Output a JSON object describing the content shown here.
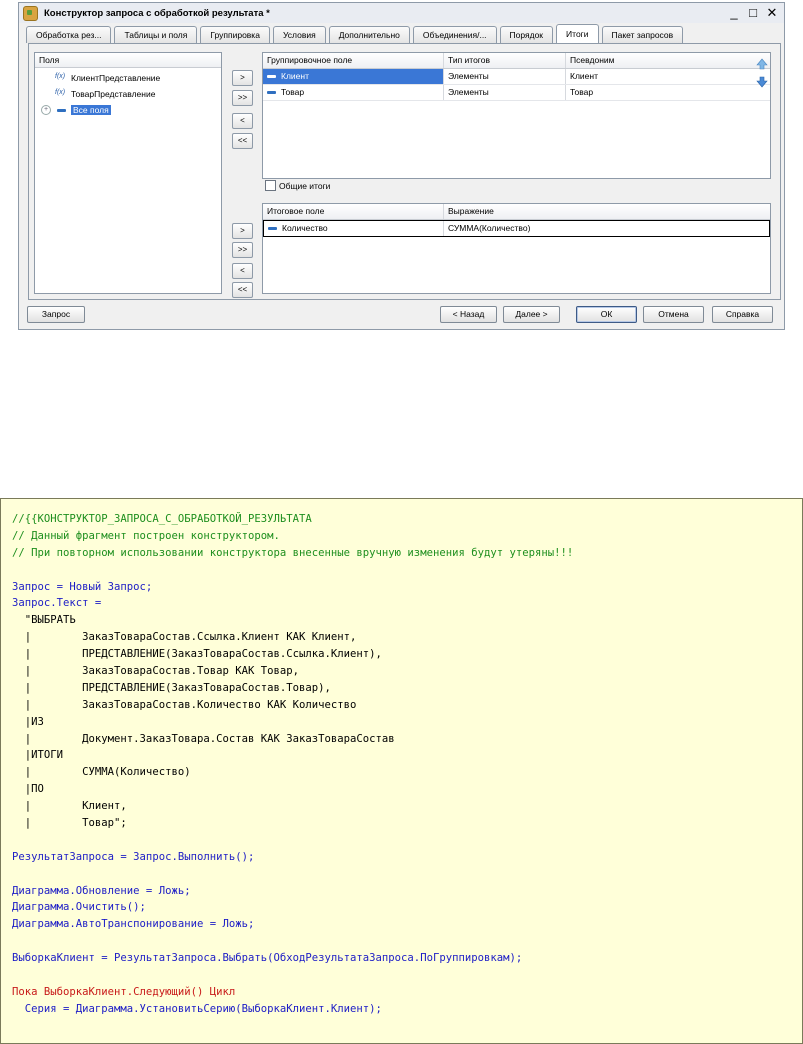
{
  "window": {
    "title": "Конструктор запроса с обработкой результата *",
    "controls": [
      "_",
      "□",
      "✕"
    ]
  },
  "tabs": [
    {
      "label": "Обработка рез...",
      "active": false
    },
    {
      "label": "Таблицы и поля",
      "active": false
    },
    {
      "label": "Группировка",
      "active": false
    },
    {
      "label": "Условия",
      "active": false
    },
    {
      "label": "Дополнительно",
      "active": false
    },
    {
      "label": "Объединения/...",
      "active": false
    },
    {
      "label": "Порядок",
      "active": false
    },
    {
      "label": "Итоги",
      "active": true
    },
    {
      "label": "Пакет запросов",
      "active": false
    }
  ],
  "fields_panel": {
    "header": "Поля",
    "items": [
      {
        "label": "КлиентПредставление",
        "icon": "fx-icon"
      },
      {
        "label": "ТоварПредставление",
        "icon": "fx-icon"
      },
      {
        "label": "Все поля",
        "icon": "line-icon",
        "selected": true
      }
    ]
  },
  "transfer_buttons_top": [
    ">",
    ">>",
    "<",
    "<<"
  ],
  "transfer_buttons_bottom": [
    ">",
    ">>",
    "<",
    "<<"
  ],
  "grouping_table": {
    "columns": [
      "Группировочное поле",
      "Тип итогов",
      "Псевдоним"
    ],
    "rows": [
      [
        "Клиент",
        "Элементы",
        "Клиент"
      ],
      [
        "Товар",
        "Элементы",
        "Товар"
      ]
    ]
  },
  "overall_totals": {
    "label": "Общие итоги",
    "checked": false
  },
  "totals_table": {
    "columns": [
      "Итоговое поле",
      "Выражение"
    ],
    "rows": [
      [
        "Количество",
        "СУММА(Количество)"
      ]
    ]
  },
  "buttons": {
    "query": "Запрос",
    "back": "< Назад",
    "next": "Далее >",
    "ok": "ОК",
    "cancel": "Отмена",
    "help": "Справка"
  },
  "code": {
    "lines": [
      {
        "text": "//{{КОНСТРУКТОР_ЗАПРОСА_С_ОБРАБОТКОЙ_РЕЗУЛЬТАТА",
        "color": "green"
      },
      {
        "text": "// Данный фрагмент построен конструктором.",
        "color": "green"
      },
      {
        "text": "// При повторном использовании конструктора внесенные вручную изменения будут утеряны!!!",
        "color": "green"
      },
      {
        "text": "",
        "color": "black"
      },
      {
        "text": "Запрос = Новый Запрос;",
        "color": "blue"
      },
      {
        "text": "Запрос.Текст =",
        "color": "blue"
      },
      {
        "text": "  \"ВЫБРАТЬ",
        "color": "black"
      },
      {
        "text": "  |        ЗаказТовараСостав.Ссылка.Клиент КАК Клиент,",
        "color": "black"
      },
      {
        "text": "  |        ПРЕДСТАВЛЕНИЕ(ЗаказТовараСостав.Ссылка.Клиент),",
        "color": "black"
      },
      {
        "text": "  |        ЗаказТовараСостав.Товар КАК Товар,",
        "color": "black"
      },
      {
        "text": "  |        ПРЕДСТАВЛЕНИЕ(ЗаказТовараСостав.Товар),",
        "color": "black"
      },
      {
        "text": "  |        ЗаказТовараСостав.Количество КАК Количество",
        "color": "black"
      },
      {
        "text": "  |ИЗ",
        "color": "black"
      },
      {
        "text": "  |        Документ.ЗаказТовара.Состав КАК ЗаказТовараСостав",
        "color": "black"
      },
      {
        "text": "  |ИТОГИ",
        "color": "black"
      },
      {
        "text": "  |        СУММА(Количество)",
        "color": "black"
      },
      {
        "text": "  |ПО",
        "color": "black"
      },
      {
        "text": "  |        Клиент,",
        "color": "black"
      },
      {
        "text": "  |        Товар\";",
        "color": "black"
      },
      {
        "text": "",
        "color": "black"
      },
      {
        "text": "РезультатЗапроса = Запрос.Выполнить();",
        "color": "blue"
      },
      {
        "text": "",
        "color": "black"
      },
      {
        "text": "Диаграмма.Обновление = Ложь;",
        "color": "blue"
      },
      {
        "text": "Диаграмма.Очистить();",
        "color": "blue"
      },
      {
        "text": "Диаграмма.АвтоТранспонирование = Ложь;",
        "color": "blue"
      },
      {
        "text": "",
        "color": "black"
      },
      {
        "text": "ВыборкаКлиент = РезультатЗапроса.Выбрать(ОбходРезультатаЗапроса.ПоГруппировкам);",
        "color": "blue"
      },
      {
        "text": "",
        "color": "black"
      },
      {
        "text": "Пока ВыборкаКлиент.Следующий() Цикл",
        "color": "red"
      },
      {
        "text": "  Серия = Диаграмма.УстановитьСерию(ВыборкаКлиент.Клиент);",
        "color": "blue"
      }
    ]
  }
}
